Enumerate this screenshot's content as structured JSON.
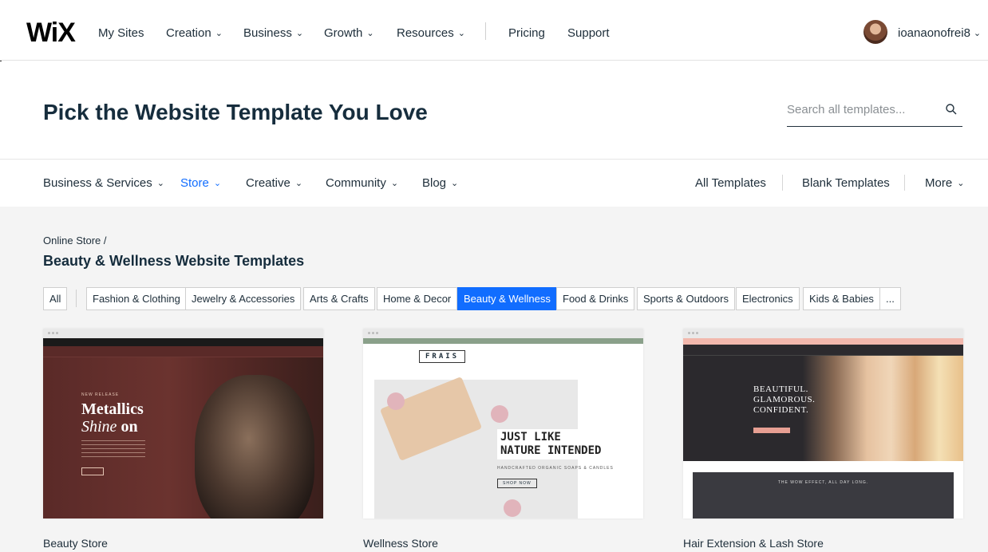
{
  "nav": {
    "logo": "WiX",
    "items": [
      "My Sites",
      "Creation",
      "Business",
      "Growth",
      "Resources",
      "Pricing",
      "Support"
    ],
    "username": "ioanaonofrei8"
  },
  "hero": {
    "title": "Pick the Website Template You Love",
    "search_placeholder": "Search all templates..."
  },
  "categories": {
    "left": [
      "Business & Services",
      "Store",
      "Creative",
      "Community",
      "Blog"
    ],
    "active": "Store",
    "right": [
      "All Templates",
      "Blank Templates",
      "More"
    ]
  },
  "breadcrumb": "Online Store /",
  "section_title": "Beauty & Wellness Website Templates",
  "chips": [
    "All",
    "Fashion & Clothing",
    "Jewelry & Accessories",
    "Arts & Crafts",
    "Home & Decor",
    "Beauty & Wellness",
    "Food & Drinks",
    "Sports & Outdoors",
    "Electronics",
    "Kids & Babies",
    "..."
  ],
  "active_chip": "Beauty & Wellness",
  "templates": [
    {
      "name": "Beauty Store",
      "preview": {
        "kicker": "NEW RELEASE",
        "headline_1": "Metallics",
        "headline_2_italic": "Shine",
        "headline_2_rest": " on"
      }
    },
    {
      "name": "Wellness Store",
      "preview": {
        "brand": "FRAIS",
        "tagline_1": "JUST LIKE",
        "tagline_2": "NATURE INTENDED",
        "sub": "HANDCRAFTED ORGANIC SOAPS & CANDLES",
        "button": "SHOP NOW"
      }
    },
    {
      "name": "Hair Extension & Lash Store",
      "preview": {
        "line_1": "BEAUTIFUL.",
        "line_2": "GLAMOROUS.",
        "line_3": "CONFIDENT.",
        "banner": "THE WOW EFFECT, ALL DAY LONG."
      }
    }
  ],
  "colors": {
    "accent": "#116dff",
    "title": "#162d3d",
    "text": "#20303c"
  },
  "icons": {
    "search": "search-icon",
    "chevron": "chevron-down-icon",
    "avatar": "avatar"
  }
}
